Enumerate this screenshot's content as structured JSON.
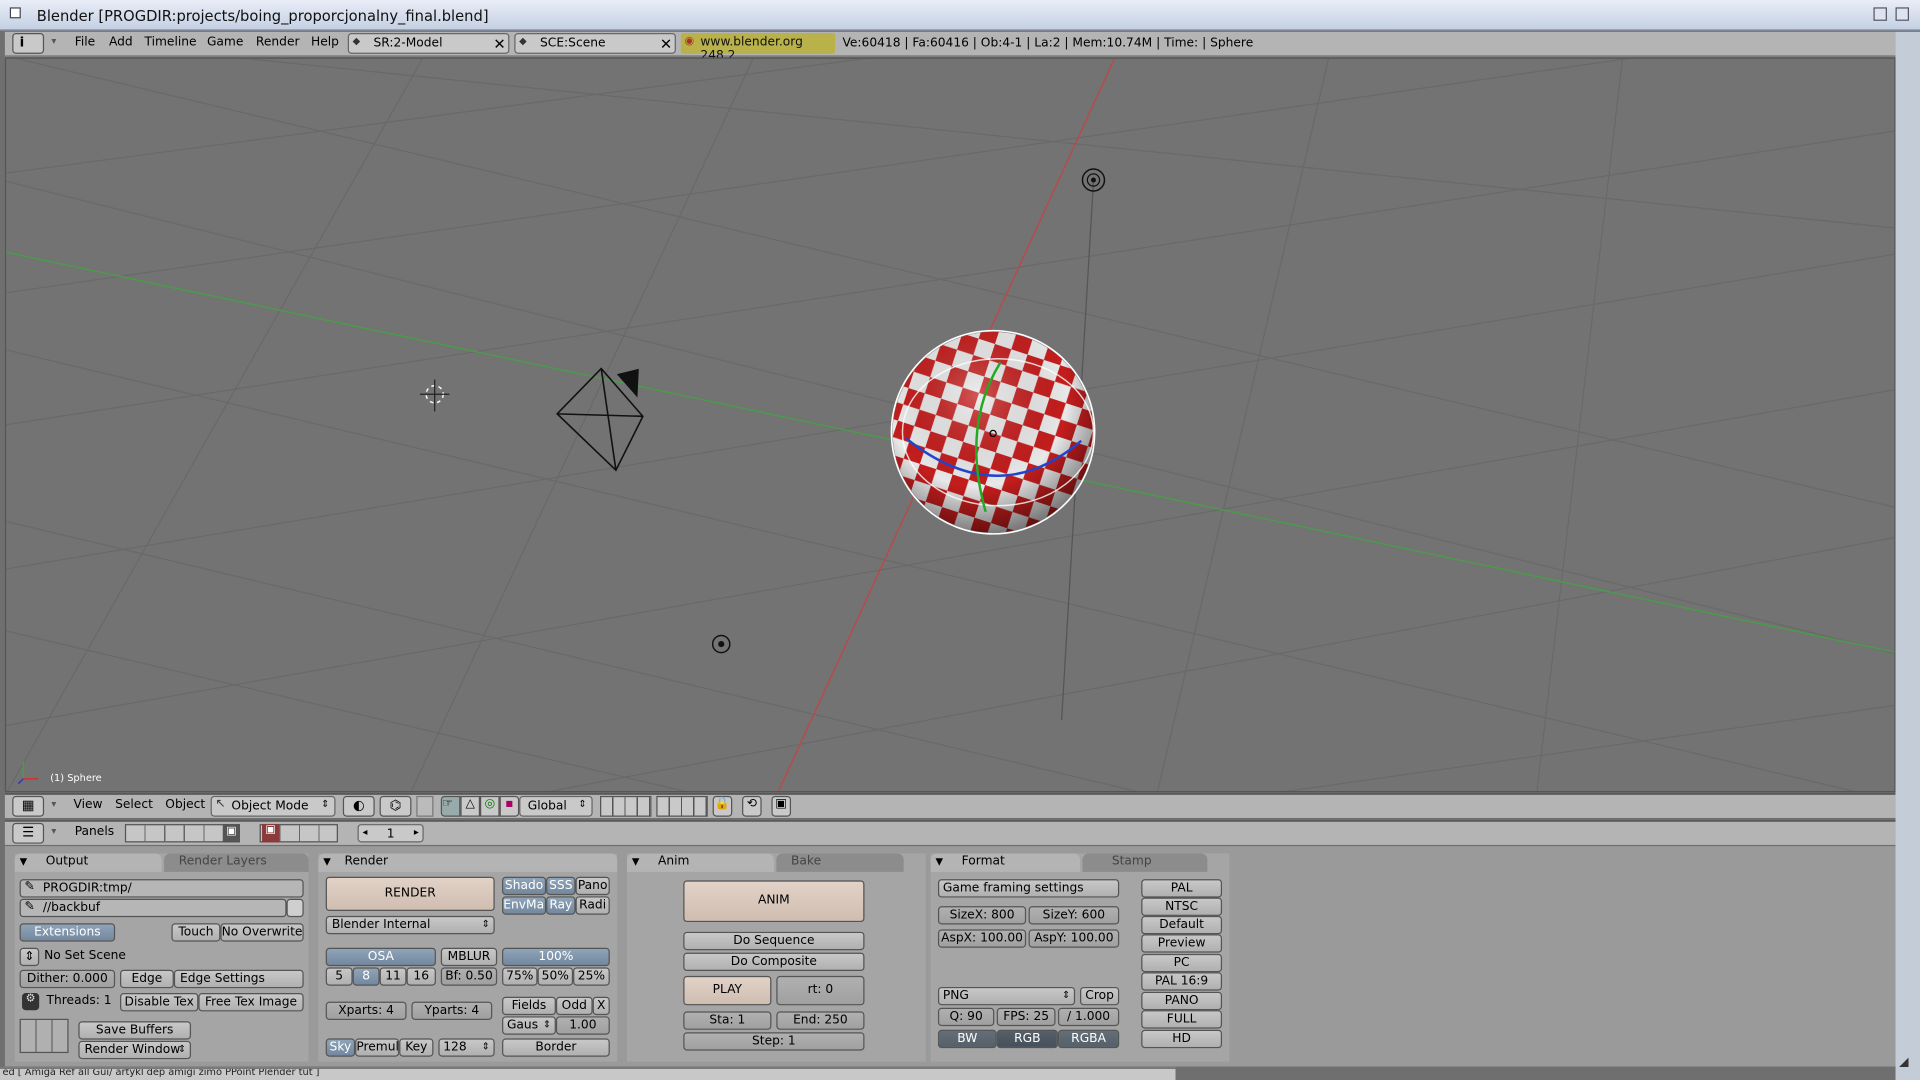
{
  "window": {
    "title": "Blender [PROGDIR:projects/boing_proporcjonalny_final.blend]"
  },
  "menubar": {
    "menus": [
      "File",
      "Add",
      "Timeline",
      "Game",
      "Render",
      "Help"
    ],
    "screen": "SR:2-Model",
    "scene": "SCE:Scene",
    "url": "www.blender.org 248.2",
    "stats": "Ve:60418 | Fa:60416 | Ob:4-1 | La:2  | Mem:10.74M  | Time: | Sphere"
  },
  "viewport": {
    "object_label": "(1) Sphere"
  },
  "view_header": {
    "menus": [
      "View",
      "Select",
      "Object"
    ],
    "mode": "Object Mode",
    "orientation": "Global"
  },
  "buttons_header": {
    "panels_label": "Panels",
    "frame": "1"
  },
  "output_panel": {
    "tabs": [
      "Output",
      "Render Layers"
    ],
    "path1": "PROGDIR:tmp/",
    "path2": "//backbuf",
    "extensions": "Extensions",
    "touch": "Touch",
    "no_overwrite": "No Overwrite",
    "no_set_scene": "No Set Scene",
    "dither": "Dither: 0.000",
    "edge": "Edge",
    "edge_settings": "Edge Settings",
    "threads": "Threads: 1",
    "disable_tex": "Disable Tex",
    "free_tex_image": "Free Tex Image",
    "save_buffers": "Save Buffers",
    "render_window": "Render Window"
  },
  "render_panel": {
    "tab": "Render",
    "render": "RENDER",
    "shado": "Shado",
    "sss": "SSS",
    "pano": "Pano",
    "envmap": "EnvMap",
    "ray": "Ray",
    "radi": "Radi",
    "engine": "Blender Internal",
    "osa": "OSA",
    "osa_values": [
      "5",
      "8",
      "11",
      "16"
    ],
    "mblur": "MBLUR",
    "bf": "Bf: 0.50",
    "pct100": "100%",
    "pcts": [
      "75%",
      "50%",
      "25%"
    ],
    "xparts": "Xparts: 4",
    "yparts": "Yparts: 4",
    "fields": "Fields",
    "odd": "Odd",
    "x": "X",
    "gaus": "Gaus",
    "gaus_val": "1.00",
    "sky": "Sky",
    "premul": "Premul",
    "key": "Key",
    "bits": "128",
    "border": "Border"
  },
  "anim_panel": {
    "tabs": [
      "Anim",
      "Bake"
    ],
    "anim": "ANIM",
    "do_sequence": "Do Sequence",
    "do_composite": "Do Composite",
    "play": "PLAY",
    "rt": "rt: 0",
    "sta": "Sta: 1",
    "end": "End: 250",
    "step": "Step: 1"
  },
  "format_panel": {
    "tabs": [
      "Format",
      "Stamp"
    ],
    "game_framing": "Game framing settings",
    "sizex": "SizeX: 800",
    "sizey": "SizeY: 600",
    "aspx": "AspX: 100.00",
    "aspy": "AspY: 100.00",
    "filetype": "PNG",
    "crop": "Crop",
    "q": "Q: 90",
    "fps": "FPS: 25",
    "fpsbase": "/ 1.000",
    "bw": "BW",
    "rgb": "RGB",
    "rgba": "RGBA",
    "presets": [
      "PAL",
      "NTSC",
      "Default",
      "Preview",
      "PC",
      "PAL 16:9",
      "PANO",
      "FULL",
      "HD"
    ]
  },
  "statusbar": {
    "text": "ed [ Amiga Ref all Gui/ artykl dep amigi zimo PPoint Plender tut ]"
  },
  "colors": {
    "checker_red": "#c41d1d",
    "checker_white": "#e8e8e8",
    "url_bg": "#b9b24a",
    "button_blue": "#7d92a8"
  }
}
